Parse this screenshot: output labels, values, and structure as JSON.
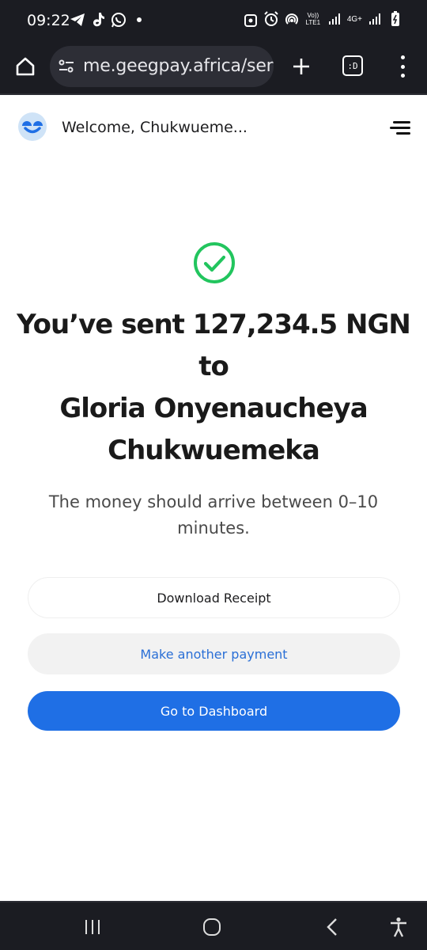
{
  "status_bar": {
    "time": "09:22",
    "left_icons": [
      "telegram-icon",
      "tiktok-icon",
      "whatsapp-icon",
      "dot-icon"
    ],
    "right_icons": [
      "vpn-lock-icon",
      "alarm-icon",
      "hotspot-icon",
      "volte-icon",
      "signal-icon",
      "4g-icon",
      "signal-icon",
      "battery-icon"
    ],
    "volte_label": "Vo)) LTE1",
    "network_label": "4G+"
  },
  "browser": {
    "url": "me.geegpay.africa/send",
    "tab_counter_label": ":D",
    "icons": [
      "home-icon",
      "tune-icon",
      "plus-icon",
      "tabs-icon",
      "more-vert-icon"
    ]
  },
  "header": {
    "welcome": "Welcome, Chukwueme...",
    "logo_icon": "geegpay-logo-icon",
    "menu_icon": "hamburger-menu-icon"
  },
  "main": {
    "success_icon": "check-circle-icon",
    "headline_line1": "You’ve sent 127,234.5 NGN",
    "headline_line2": "to",
    "headline_line3": "Gloria Onyenaucheya",
    "headline_line4": "Chukwuemeka",
    "subtext": "The money should arrive between 0–10 minutes.",
    "download_receipt_label": "Download Receipt",
    "another_payment_label": "Make another payment",
    "dashboard_label": "Go to Dashboard"
  },
  "nav_bar": {
    "icons": [
      "recent-apps-icon",
      "home-circle-icon",
      "back-icon",
      "accessibility-icon"
    ]
  },
  "colors": {
    "success_green": "#22c55e",
    "primary_blue": "#1f6fe5",
    "link_blue": "#2a6fd6",
    "chrome_dark": "#1b1c22"
  }
}
